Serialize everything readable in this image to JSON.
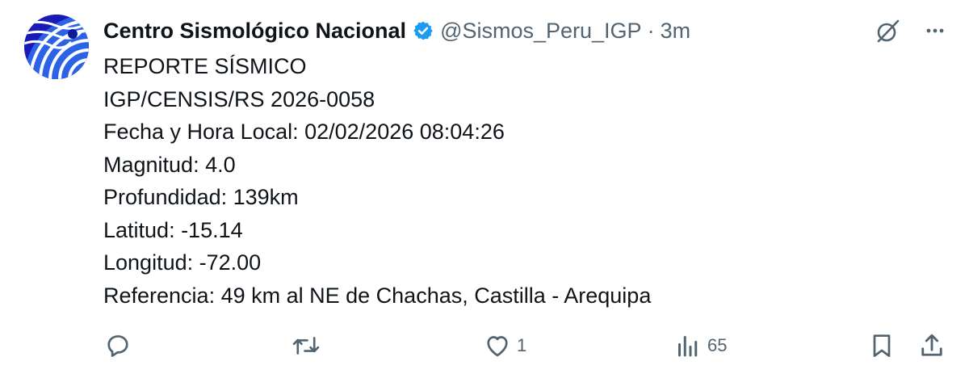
{
  "author": {
    "display_name": "Centro Sismológico Nacional",
    "handle": "@Sismos_Peru_IGP",
    "separator": "·",
    "timestamp": "3m",
    "verified_color": "#1d9bf0"
  },
  "tweet": {
    "lines": [
      "REPORTE SÍSMICO",
      "IGP/CENSIS/RS 2026-0058",
      "Fecha y Hora Local: 02/02/2026 08:04:26",
      "Magnitud: 4.0",
      "Profundidad: 139km",
      "Latitud: -15.14",
      "Longitud: -72.00",
      "Referencia: 49 km al NE de Chachas, Castilla - Arequipa"
    ]
  },
  "actions": {
    "reply_icon": "reply-icon",
    "repost_icon": "repost-icon",
    "like_icon": "heart-icon",
    "like_count": "1",
    "views_icon": "analytics-icon",
    "views_count": "65",
    "bookmark_icon": "bookmark-icon",
    "share_icon": "share-icon"
  },
  "colors": {
    "text": "#0f1419",
    "secondary": "#536471",
    "accent": "#1d9bf0",
    "avatar_bg": "#0b1b9a"
  }
}
